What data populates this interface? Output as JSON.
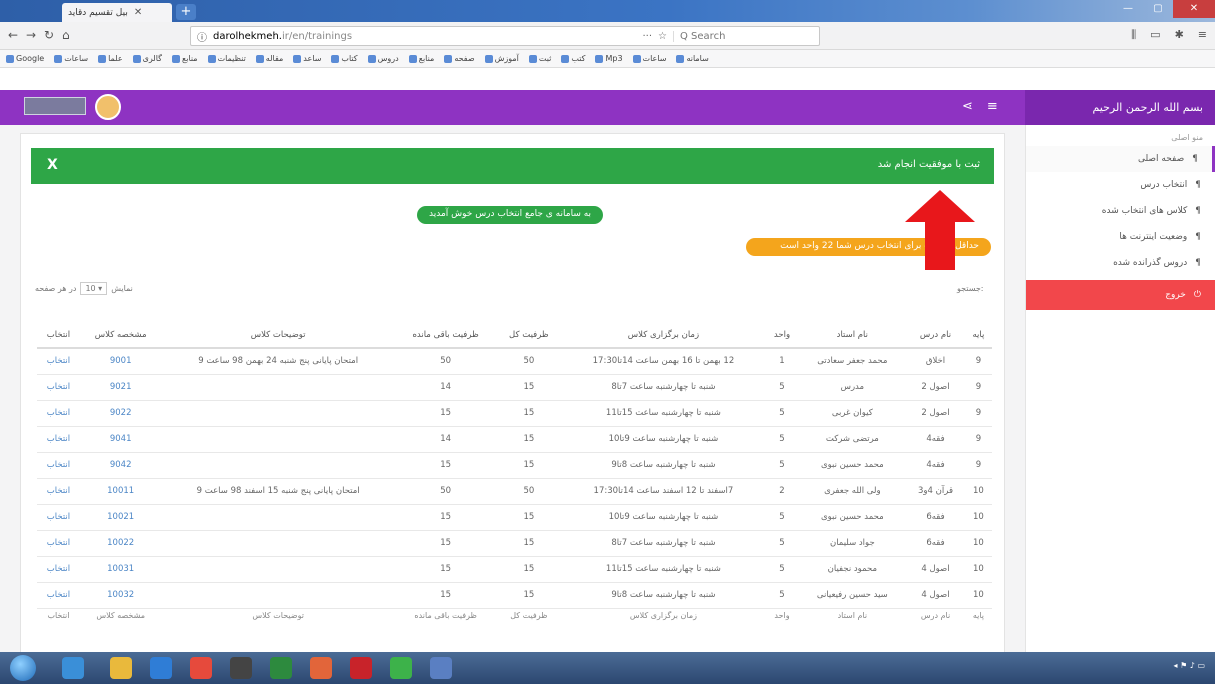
{
  "browser": {
    "tab_title": "بیل تقسیم دقاید",
    "url_domain": "darolhekmeh.",
    "url_rest": "ir/en/trainings",
    "search_placeholder": "Q Search",
    "nav_icons": [
      "back-icon",
      "forward-icon",
      "reload-icon",
      "home-icon"
    ],
    "bookmarks": [
      "Google",
      "ساعات",
      "علما",
      "گالری",
      "منابع",
      "تنظیمات",
      "مقاله",
      "ساعد",
      "کتاب",
      "دروس",
      "منابع",
      "صفحه",
      "آموزش",
      "ثبت",
      "کتب",
      "Mp3",
      "ساعات",
      "سامانه"
    ]
  },
  "app": {
    "brand": "بسم الله الرحمن الرحيم",
    "sidebar_header": "منو اصلی",
    "sidebar_items": [
      {
        "label": "صفحه اصلی",
        "active": true
      },
      {
        "label": "انتخاب درس",
        "active": false
      },
      {
        "label": "کلاس های انتخاب شده",
        "active": false
      },
      {
        "label": "وضعیت اینترنت ها",
        "active": false
      },
      {
        "label": "دروس گذرانده شده",
        "active": false
      }
    ],
    "logout_label": "خروج"
  },
  "main": {
    "alert_text": "ثبت با موفقیت انجام شد",
    "alert_close": "X",
    "welcome_pill": "به سامانه ی جامع انتخاب درس خوش آمدید",
    "warn_pill": "حداقل ظرفیت برای انتخاب درس شما 22 واحد است",
    "length_label": "نمایش",
    "length_value": "10",
    "length_suffix": "در هر صفحه",
    "search_label": "جستجو:"
  },
  "table": {
    "headers": [
      "پایه",
      "نام درس",
      "نام استاد",
      "واحد",
      "زمان برگزاری کلاس",
      "ظرفیت کل",
      "ظرفیت باقی مانده",
      "توضیحات کلاس",
      "مشخصه کلاس",
      "انتخاب"
    ],
    "rows": [
      [
        "9",
        "اخلاق",
        "محمد جعفر سعادتی",
        "1",
        "12 بهمن تا 16 بهمن ساعت 14تا17:30",
        "50",
        "50",
        "امتحان پایانی پنج شنبه 24 بهمن 98 ساعت 9",
        "9001",
        "انتخاب"
      ],
      [
        "9",
        "اصول 2",
        "مدرس",
        "5",
        "شنبه تا چهارشنبه ساعت 7تا8",
        "15",
        "14",
        "",
        "9021",
        "انتخاب"
      ],
      [
        "9",
        "اصول 2",
        "کیوان غربی",
        "5",
        "شنبه تا چهارشنبه ساعت 15تا11",
        "15",
        "15",
        "",
        "9022",
        "انتخاب"
      ],
      [
        "9",
        "فقه4",
        "مرتضی شرکت",
        "5",
        "شنبه تا چهارشنبه ساعت 9تا10",
        "15",
        "14",
        "",
        "9041",
        "انتخاب"
      ],
      [
        "9",
        "فقه4",
        "محمد حسین نبوی",
        "5",
        "شنبه تا چهارشنبه ساعت 8تا9",
        "15",
        "15",
        "",
        "9042",
        "انتخاب"
      ],
      [
        "10",
        "قرآن 4و3",
        "ولی الله جعفری",
        "2",
        "7اسفند تا 12 اسفند ساعت 14تا17:30",
        "50",
        "50",
        "امتحان پایانی پنج شنبه 15 اسفند 98 ساعت 9",
        "10011",
        "انتخاب"
      ],
      [
        "10",
        "فقه6",
        "محمد حسین نبوی",
        "5",
        "شنبه تا چهارشنبه ساعت 9تا10",
        "15",
        "15",
        "",
        "10021",
        "انتخاب"
      ],
      [
        "10",
        "فقه6",
        "جواد سلیمان",
        "5",
        "شنبه تا چهارشنبه ساعت 7تا8",
        "15",
        "15",
        "",
        "10022",
        "انتخاب"
      ],
      [
        "10",
        "اصول 4",
        "محمود نجفیان",
        "5",
        "شنبه تا چهارشنبه ساعت 15تا11",
        "15",
        "15",
        "",
        "10031",
        "انتخاب"
      ],
      [
        "10",
        "اصول 4",
        "سید حسین رفیعیانی",
        "5",
        "شنبه تا چهارشنبه ساعت 8تا9",
        "15",
        "15",
        "",
        "10032",
        "انتخاب"
      ]
    ],
    "footer": [
      "پایه",
      "نام درس",
      "نام استاد",
      "واحد",
      "زمان برگزاری کلاس",
      "ظرفیت کل",
      "ظرفیت باقی مانده",
      "توضیحات کلاس",
      "مشخصه کلاس",
      "انتخاب"
    ]
  },
  "colors": {
    "accent": "#8e33c2",
    "success": "#2ea647",
    "warning": "#f4a51c",
    "danger": "#f2474b",
    "arrow": "#e8171b"
  }
}
